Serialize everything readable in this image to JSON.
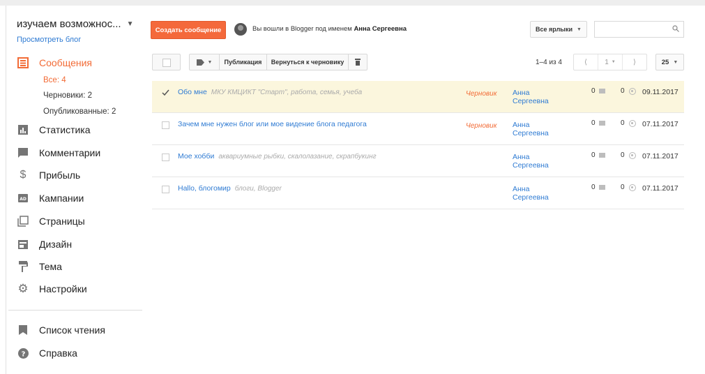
{
  "sidebar": {
    "blog_title": "изучаем возможнос...",
    "view_blog": "Просмотреть блог",
    "nav": [
      {
        "label": "Сообщения",
        "icon": "posts-icon"
      },
      {
        "label": "Статистика",
        "icon": "stats-icon"
      },
      {
        "label": "Комментарии",
        "icon": "comments-icon"
      },
      {
        "label": "Прибыль",
        "icon": "dollar-icon"
      },
      {
        "label": "Кампании",
        "icon": "ads-icon"
      },
      {
        "label": "Страницы",
        "icon": "pages-icon"
      },
      {
        "label": "Дизайн",
        "icon": "layout-icon"
      },
      {
        "label": "Тема",
        "icon": "paint-roller-icon"
      },
      {
        "label": "Настройки",
        "icon": "gear-icon"
      }
    ],
    "sub": [
      "Все: 4",
      "Черновики: 2",
      "Опубликованные: 2"
    ],
    "bottom": [
      {
        "label": "Список чтения",
        "icon": "bookmark-icon"
      },
      {
        "label": "Справка",
        "icon": "help-icon"
      }
    ]
  },
  "header": {
    "create_post": "Создать сообщение",
    "logged_in_prefix": "Вы вошли в Blogger под именем",
    "user_name": "Анна Сергеевна",
    "labels_filter": "Все ярлыки",
    "search_placeholder": ""
  },
  "toolbar": {
    "publish": "Публикация",
    "revert_to_draft": "Вернуться к черновику",
    "count_text": "1–4 из 4",
    "page": "1",
    "per_page": "25"
  },
  "posts": [
    {
      "title": "Обо мне",
      "labels": "МКУ КМЦИКТ \"Старт\", работа, семья, учеба",
      "status": "Черновик",
      "author_first": "Анна",
      "author_last": "Сергеевна",
      "comments": "0",
      "views": "0",
      "date": "09.11.2017",
      "checked": true
    },
    {
      "title": "Зачем мне нужен блог или мое видение блога педагога",
      "labels": "",
      "status": "Черновик",
      "author_first": "Анна",
      "author_last": "Сергеевна",
      "comments": "0",
      "views": "0",
      "date": "07.11.2017",
      "checked": false
    },
    {
      "title": "Мое хобби",
      "labels": "аквариумные рыбки, скалолазание, скрапбукинг",
      "status": "",
      "author_first": "Анна",
      "author_last": "Сергеевна",
      "comments": "0",
      "views": "0",
      "date": "07.11.2017",
      "checked": false
    },
    {
      "title": "Hallo, блогомир",
      "labels": "блоги, Blogger",
      "status": "",
      "author_first": "Анна",
      "author_last": "Сергеевна",
      "comments": "0",
      "views": "0",
      "date": "07.11.2017",
      "checked": false
    }
  ],
  "colors": {
    "accent": "#f26b36",
    "link": "#2f7bd3",
    "selected_row": "#fbf6dd"
  }
}
